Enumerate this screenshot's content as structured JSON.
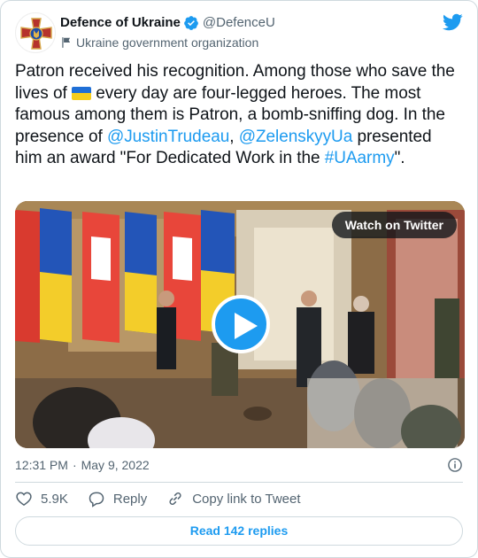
{
  "author": {
    "display_name": "Defence of Ukraine",
    "handle": "@DefenceU",
    "affiliation": "Ukraine government organization",
    "avatar_icon": "ukraine-defence-emblem-icon",
    "verified_icon": "verified-badge-icon"
  },
  "platform_icon": "twitter-bird-icon",
  "tweet": {
    "segments": [
      {
        "text": "Patron received his recognition. Among those who save the lives of ",
        "type": "text"
      },
      {
        "text": "🇺🇦",
        "type": "emoji"
      },
      {
        "text": " every day are four-legged heroes. The most famous among them is Patron, a bomb-sniffing dog. In the presence of ",
        "type": "text"
      },
      {
        "text": "@JustinTrudeau",
        "type": "link"
      },
      {
        "text": ", ",
        "type": "text"
      },
      {
        "text": "@ZelenskyyUa",
        "type": "link"
      },
      {
        "text": " presented him an award \"For Dedicated Work in the ",
        "type": "text"
      },
      {
        "text": "#UAarmy",
        "type": "link"
      },
      {
        "text": "\".",
        "type": "text"
      }
    ]
  },
  "media": {
    "watch_label": "Watch on Twitter",
    "play_icon": "play-icon"
  },
  "meta": {
    "time": "12:31 PM",
    "separator": "·",
    "date": "May 9, 2022",
    "info_icon": "info-icon"
  },
  "actions": {
    "likes": "5.9K",
    "reply_label": "Reply",
    "copy_label": "Copy link to Tweet"
  },
  "replies_button": "Read 142 replies",
  "colors": {
    "link": "#1d9bf0",
    "text": "#0f1419",
    "muted": "#536471",
    "border": "#cfd9de"
  }
}
